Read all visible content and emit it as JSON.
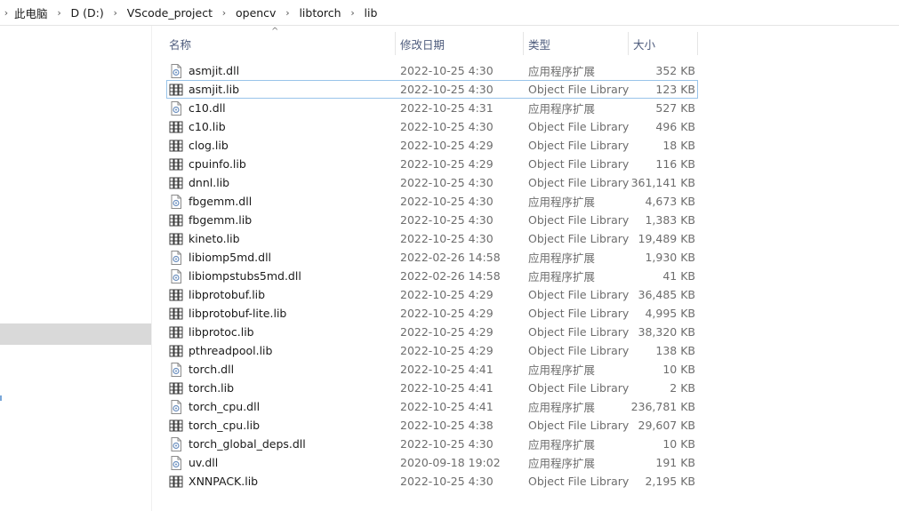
{
  "breadcrumb": {
    "items": [
      "此电脑",
      "D (D:)",
      "VScode_project",
      "opencv",
      "libtorch",
      "lib"
    ]
  },
  "columns": {
    "name": "名称",
    "date": "修改日期",
    "type": "类型",
    "size": "大小"
  },
  "files": [
    {
      "name": "asmjit.dll",
      "date": "2022-10-25 4:30",
      "type": "应用程序扩展",
      "size": "352 KB",
      "icon": "dll-file-icon"
    },
    {
      "name": "asmjit.lib",
      "date": "2022-10-25 4:30",
      "type": "Object File Library",
      "size": "123 KB",
      "icon": "lib-file-icon"
    },
    {
      "name": "c10.dll",
      "date": "2022-10-25 4:31",
      "type": "应用程序扩展",
      "size": "527 KB",
      "icon": "dll-file-icon"
    },
    {
      "name": "c10.lib",
      "date": "2022-10-25 4:30",
      "type": "Object File Library",
      "size": "496 KB",
      "icon": "lib-file-icon"
    },
    {
      "name": "clog.lib",
      "date": "2022-10-25 4:29",
      "type": "Object File Library",
      "size": "18 KB",
      "icon": "lib-file-icon"
    },
    {
      "name": "cpuinfo.lib",
      "date": "2022-10-25 4:29",
      "type": "Object File Library",
      "size": "116 KB",
      "icon": "lib-file-icon"
    },
    {
      "name": "dnnl.lib",
      "date": "2022-10-25 4:30",
      "type": "Object File Library",
      "size": "361,141 KB",
      "icon": "lib-file-icon"
    },
    {
      "name": "fbgemm.dll",
      "date": "2022-10-25 4:30",
      "type": "应用程序扩展",
      "size": "4,673 KB",
      "icon": "dll-file-icon"
    },
    {
      "name": "fbgemm.lib",
      "date": "2022-10-25 4:30",
      "type": "Object File Library",
      "size": "1,383 KB",
      "icon": "lib-file-icon"
    },
    {
      "name": "kineto.lib",
      "date": "2022-10-25 4:30",
      "type": "Object File Library",
      "size": "19,489 KB",
      "icon": "lib-file-icon"
    },
    {
      "name": "libiomp5md.dll",
      "date": "2022-02-26 14:58",
      "type": "应用程序扩展",
      "size": "1,930 KB",
      "icon": "dll-file-icon"
    },
    {
      "name": "libiompstubs5md.dll",
      "date": "2022-02-26 14:58",
      "type": "应用程序扩展",
      "size": "41 KB",
      "icon": "dll-file-icon"
    },
    {
      "name": "libprotobuf.lib",
      "date": "2022-10-25 4:29",
      "type": "Object File Library",
      "size": "36,485 KB",
      "icon": "lib-file-icon"
    },
    {
      "name": "libprotobuf-lite.lib",
      "date": "2022-10-25 4:29",
      "type": "Object File Library",
      "size": "4,995 KB",
      "icon": "lib-file-icon"
    },
    {
      "name": "libprotoc.lib",
      "date": "2022-10-25 4:29",
      "type": "Object File Library",
      "size": "38,320 KB",
      "icon": "lib-file-icon"
    },
    {
      "name": "pthreadpool.lib",
      "date": "2022-10-25 4:29",
      "type": "Object File Library",
      "size": "138 KB",
      "icon": "lib-file-icon"
    },
    {
      "name": "torch.dll",
      "date": "2022-10-25 4:41",
      "type": "应用程序扩展",
      "size": "10 KB",
      "icon": "dll-file-icon"
    },
    {
      "name": "torch.lib",
      "date": "2022-10-25 4:41",
      "type": "Object File Library",
      "size": "2 KB",
      "icon": "lib-file-icon"
    },
    {
      "name": "torch_cpu.dll",
      "date": "2022-10-25 4:41",
      "type": "应用程序扩展",
      "size": "236,781 KB",
      "icon": "dll-file-icon"
    },
    {
      "name": "torch_cpu.lib",
      "date": "2022-10-25 4:38",
      "type": "Object File Library",
      "size": "29,607 KB",
      "icon": "lib-file-icon"
    },
    {
      "name": "torch_global_deps.dll",
      "date": "2022-10-25 4:30",
      "type": "应用程序扩展",
      "size": "10 KB",
      "icon": "dll-file-icon"
    },
    {
      "name": "uv.dll",
      "date": "2020-09-18 19:02",
      "type": "应用程序扩展",
      "size": "191 KB",
      "icon": "dll-file-icon"
    },
    {
      "name": "XNNPACK.lib",
      "date": "2022-10-25 4:30",
      "type": "Object File Library",
      "size": "2,195 KB",
      "icon": "lib-file-icon"
    }
  ],
  "focused_row": 1,
  "colors": {
    "focus_border": "#99c4ea",
    "nav_selected": "#d9d9d9",
    "header_text": "#4d5b7c"
  }
}
